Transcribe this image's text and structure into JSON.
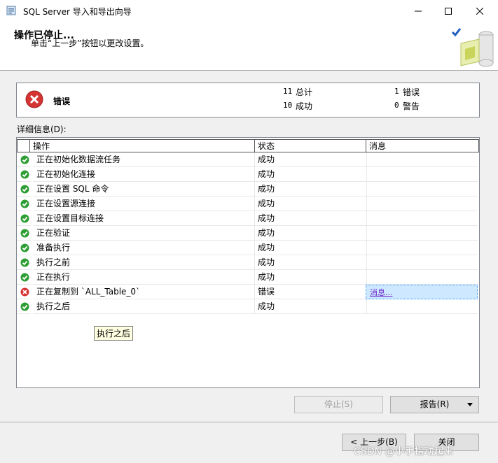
{
  "window": {
    "title": "SQL Server 导入和导出向导"
  },
  "header": {
    "title": "操作已停止...",
    "subtitle": "单击“上一步”按钮以更改设置。"
  },
  "summary": {
    "status_label": "错误",
    "total_count": "11",
    "total_label": "总计",
    "success_count": "10",
    "success_label": "成功",
    "error_count": "1",
    "error_label": "错误",
    "warning_count": "0",
    "warning_label": "警告"
  },
  "details_label": "详细信息(D):",
  "grid": {
    "columns": [
      "操作",
      "状态",
      "消息"
    ],
    "rows": [
      {
        "icon": "success-icon",
        "action": "正在初始化数据流任务",
        "status": "成功",
        "message": ""
      },
      {
        "icon": "success-icon",
        "action": "正在初始化连接",
        "status": "成功",
        "message": ""
      },
      {
        "icon": "success-icon",
        "action": "正在设置 SQL 命令",
        "status": "成功",
        "message": ""
      },
      {
        "icon": "success-icon",
        "action": "正在设置源连接",
        "status": "成功",
        "message": ""
      },
      {
        "icon": "success-icon",
        "action": "正在设置目标连接",
        "status": "成功",
        "message": ""
      },
      {
        "icon": "success-icon",
        "action": "正在验证",
        "status": "成功",
        "message": ""
      },
      {
        "icon": "success-icon",
        "action": "准备执行",
        "status": "成功",
        "message": ""
      },
      {
        "icon": "success-icon",
        "action": "执行之前",
        "status": "成功",
        "message": ""
      },
      {
        "icon": "success-icon",
        "action": "正在执行",
        "status": "成功",
        "message": ""
      },
      {
        "icon": "error-icon",
        "action": "正在复制到 `ALL_Table_0`",
        "status": "错误",
        "message": "消息..."
      },
      {
        "icon": "success-icon",
        "action": "执行之后",
        "status": "成功",
        "message": ""
      }
    ]
  },
  "tooltip": "执行之后",
  "buttons": {
    "stop": "停止(S)",
    "report": "报告(R)",
    "previous": "< 上一步(B)",
    "close": "关闭"
  },
  "watermark": "CSDN @小手指动起来",
  "colors": {
    "success": "#2e9e34",
    "error": "#d43434",
    "selection": "#cde8ff",
    "link": "#6b28c8"
  }
}
